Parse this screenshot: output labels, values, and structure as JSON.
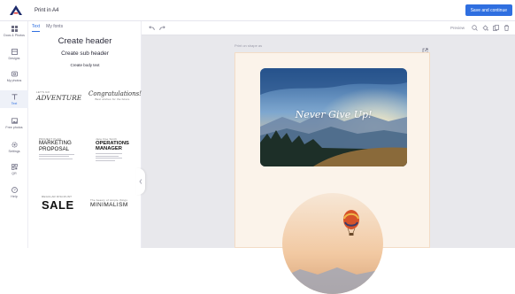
{
  "app": {
    "title": "Print in A4",
    "save_label": "Save and continue"
  },
  "rail": [
    {
      "label": "Docs & Photos",
      "icon": "grid-icon"
    },
    {
      "label": "Designs",
      "icon": "designs-icon"
    },
    {
      "label": "My photos",
      "icon": "photos-icon"
    },
    {
      "label": "Text",
      "icon": "text-icon"
    },
    {
      "label": "Free photos",
      "icon": "image-icon"
    },
    {
      "label": "Settings",
      "icon": "settings-icon"
    },
    {
      "label": "QR",
      "icon": "qr-icon"
    },
    {
      "label": "Help",
      "icon": "help-icon"
    }
  ],
  "panel": {
    "tabs": [
      "Text",
      "My fonts"
    ],
    "create_header": "Create header",
    "create_sub_header": "Create sub header",
    "create_body_text": "Create body text",
    "templates": {
      "t1_small": "LET'S GO",
      "t1_big": "ADVENTURE",
      "t2_big": "Congratulations!",
      "t2_small": "Best wishes for the future",
      "t3_small": "PROJECT PLAN",
      "t3_big_1": "MARKETING",
      "t3_big_2": "PROPOSAL",
      "t4_small": "Jane Doe Smith",
      "t4_big_1": "OPERATIONS",
      "t4_big_2": "MANAGER",
      "t5_small": "REGULAR DISCOUNT",
      "t5_big": "SALE",
      "t6_small": "The beauty of simple things",
      "t6_big": "MINIMALISM"
    }
  },
  "canvas": {
    "preview_label": "Preview",
    "page_label": "Print on shape as",
    "photo_text": "Never Give Up!"
  },
  "colors": {
    "accent": "#2f6fe0",
    "page_bg": "#fbf3ea",
    "page_border": "#f3dcc6",
    "canvas_bg": "#e8e8ec"
  }
}
